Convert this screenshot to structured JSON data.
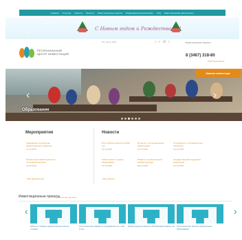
{
  "topnav": {
    "items": [
      "Главная",
      "О центре",
      "Новости",
      "Проекты",
      "Инвестиционные проекты",
      "Информационный материал",
      "FAQ",
      "Инвестиционная деятельность"
    ]
  },
  "banner": {
    "greeting": "С Новым годом и Рождеством!!!"
  },
  "header": {
    "logo_line1": "РЕГИОНАЛЬНЫЙ",
    "logo_line2": "ЦЕНТР ИНВЕСТИЦИЙ",
    "contrast": "Рус | Eng | 中文",
    "site_links": "Инвестиционные Проекты",
    "phone": "8 (3467) 318-80",
    "phone_sub": "Обратный звонок"
  },
  "hero": {
    "caption": "Образование",
    "cta": "Заявка инвестора"
  },
  "news": {
    "left_title": "Мероприятия",
    "mid_title": "Новости",
    "left_items": [
      {
        "title": "Совещание по вопросам инвестиционного развития",
        "date": "17.12.2016"
      },
      {
        "title": "Презентация инвестиционного потенциала региона",
        "date": "10.12.2016"
      }
    ],
    "mid_items": [
      {
        "title": "Итоги работы центра за 2016 год",
        "date": "20.12.2016"
      },
      {
        "title": "Новый проект в сфере образования",
        "date": "16.12.2016"
      },
      {
        "title": "Встреча с потенциальными инвесторами",
        "date": "12.12.2016"
      },
      {
        "title": "Развитие промышленной инфраструктуры",
        "date": "08.12.2016"
      },
      {
        "title": "Конкурс инвестиционных проектов",
        "date": "05.12.2016"
      },
      {
        "title": "Форум предпринимателей",
        "date": "01.12.2016"
      }
    ],
    "right_items": [
      {
        "title": "Соглашение о сотрудничестве подписано",
        "date": "19.12.2016"
      },
      {
        "title": "Государственная поддержка инвесторов",
        "date": "13.12.2016"
      },
      {
        "title": "Отчёт о реализации проектов",
        "date": "07.12.2016"
      }
    ],
    "all_events": "› Все мероприятия",
    "all_news": "› Все новости"
  },
  "projects": {
    "title": "Инвестиционные проекты",
    "link": "Смотреть все проекты",
    "cards": [
      "Жилье в типовых недостроенных жилых отходах",
      "Строительство завода по переработке 3-х тонн в год",
      "Реконструкция объекта «Рыбоводный завод» на",
      "Строительство объекта дошкольного образования"
    ]
  }
}
